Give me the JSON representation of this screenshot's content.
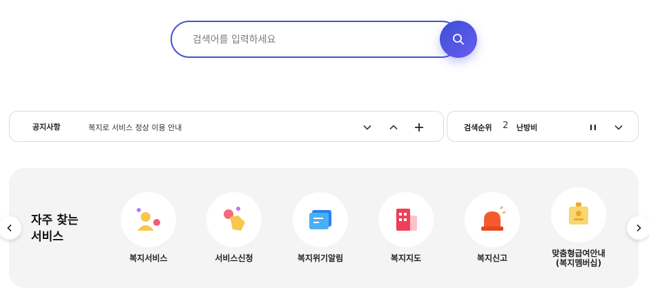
{
  "search": {
    "placeholder": "검색어를 입력하세요",
    "value": ""
  },
  "notice": {
    "title": "공지사항",
    "text": "복지로 서비스 정상 이용 안내"
  },
  "ranking": {
    "title": "검색순위",
    "rank": "2",
    "keyword": "난방비"
  },
  "services": {
    "heading_line1": "자주 찾는",
    "heading_line2": "서비스",
    "items": [
      {
        "label": "복지서비스",
        "icon": "person-icon"
      },
      {
        "label": "서비스신청",
        "icon": "hand-tap-icon"
      },
      {
        "label": "복지위기알림",
        "icon": "message-icon"
      },
      {
        "label": "복지지도",
        "icon": "building-map-icon"
      },
      {
        "label": "복지신고",
        "icon": "siren-icon"
      },
      {
        "label_line1": "맞춤형급여안내",
        "label_line2": "(복지멤버십)",
        "icon": "membership-card-icon"
      }
    ]
  },
  "colors": {
    "accent": "#3d57c9",
    "panel_bg": "#f4f4f4"
  }
}
